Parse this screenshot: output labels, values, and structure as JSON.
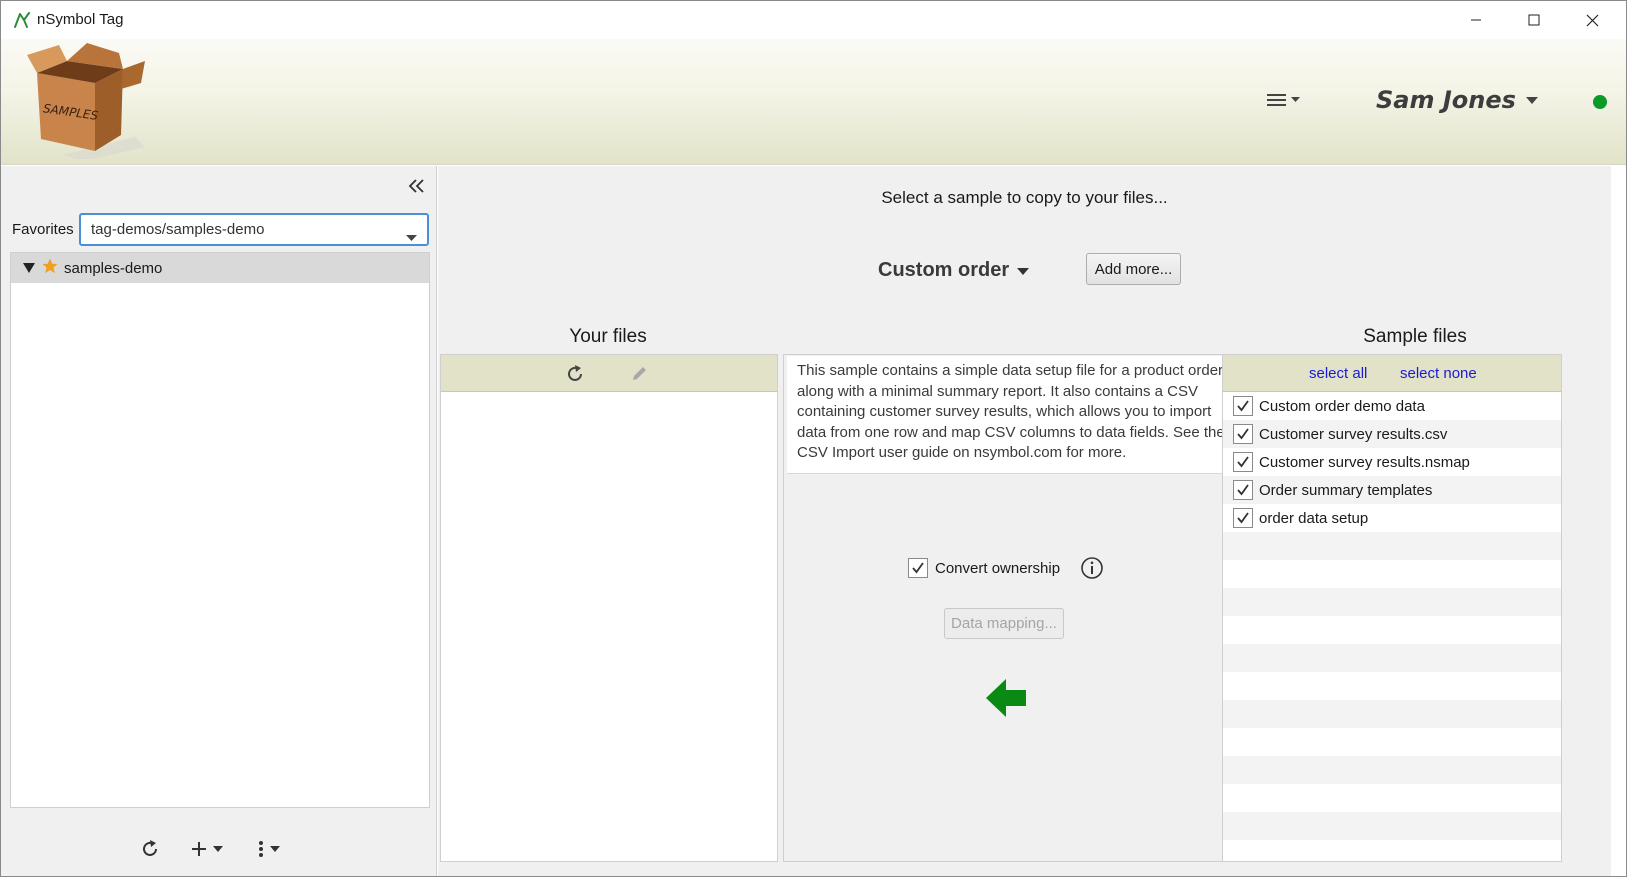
{
  "window": {
    "title": "nSymbol Tag"
  },
  "header": {
    "logo_text": "SAMPLES",
    "user_name": "Sam Jones",
    "status_color": "#0a9a2a"
  },
  "left_panel": {
    "favorites_label": "Favorites",
    "favorites_value": "tag-demos/samples-demo",
    "tree": [
      {
        "label": "samples-demo",
        "expanded": true,
        "starred": true
      }
    ]
  },
  "main": {
    "instruction": "Select a sample to copy to your files...",
    "selected_sample": "Custom order",
    "add_more_label": "Add more...",
    "your_files_title": "Your files",
    "sample_files_title": "Sample files",
    "description": "This sample contains a simple data setup file for a product order along with a minimal summary report. It also contains a CSV containing customer survey results, which allows you to import data from one row and map CSV columns to data fields. See the CSV Import user guide on nsymbol.com for more.",
    "convert_ownership_label": "Convert ownership",
    "convert_ownership_checked": true,
    "data_mapping_label": "Data mapping...",
    "select_all_label": "select all",
    "select_none_label": "select none",
    "sample_files": [
      {
        "label": "Custom order demo data",
        "checked": true
      },
      {
        "label": "Customer survey results.csv",
        "checked": true
      },
      {
        "label": "Customer survey results.nsmap",
        "checked": true
      },
      {
        "label": "Order summary templates",
        "checked": true
      },
      {
        "label": "order data setup",
        "checked": true
      }
    ]
  },
  "colors": {
    "accent_green": "#0a8a14",
    "link_blue": "#1a1ad6",
    "toolbar_bg": "#e1e2c8"
  }
}
